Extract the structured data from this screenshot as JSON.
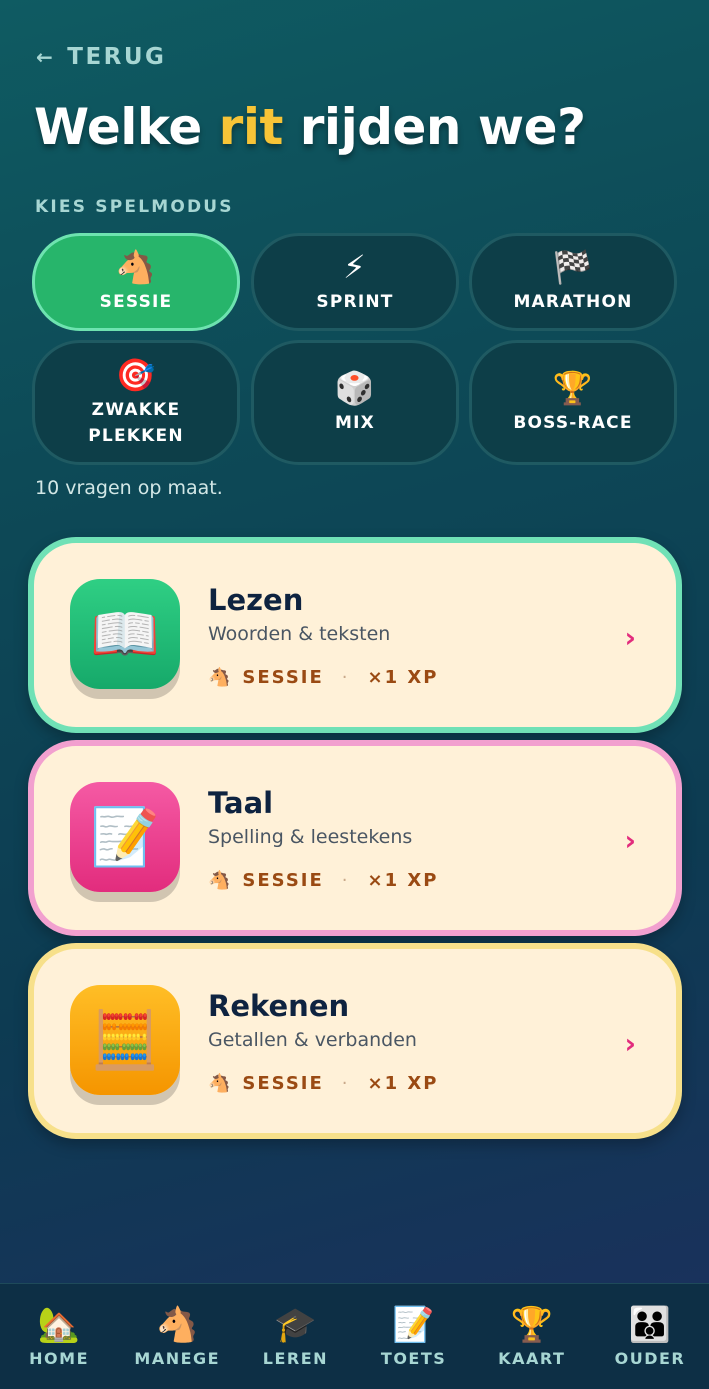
{
  "header": {
    "back_arrow": "←",
    "back_label": "TERUG",
    "title_before": "Welke ",
    "title_accent": "rit",
    "title_after": " rijden we?"
  },
  "mode_picker": {
    "heading": "KIES SPELMODUS",
    "modes": [
      {
        "label": "SESSIE",
        "icon": "🐴",
        "icon_name": "horse-icon",
        "active": true
      },
      {
        "label": "SPRINT",
        "icon": "⚡",
        "icon_name": "lightning-icon",
        "active": false
      },
      {
        "label": "MARATHON",
        "icon": "🏁",
        "icon_name": "checkered-flag-icon",
        "active": false
      },
      {
        "label": "ZWAKKE PLEKKEN",
        "icon": "🎯",
        "icon_name": "target-icon",
        "active": false
      },
      {
        "label": "MIX",
        "icon": "🎲",
        "icon_name": "dice-icon",
        "active": false
      },
      {
        "label": "BOSS-RACE",
        "icon": "🏆",
        "icon_name": "trophy-icon",
        "active": false
      }
    ],
    "hint": "10 vragen op maat."
  },
  "subjects": [
    {
      "title": "Lezen",
      "subtitle": "Woorden & teksten",
      "icon": "📖",
      "icon_name": "open-book-icon",
      "mode_icon": "🐴",
      "mode": "SESSIE",
      "dot": "·",
      "xp": "×1 XP",
      "chevron": "›",
      "border_color": "#70e1b6"
    },
    {
      "title": "Taal",
      "subtitle": "Spelling & leestekens",
      "icon": "📝",
      "icon_name": "writing-icon",
      "mode_icon": "🐴",
      "mode": "SESSIE",
      "dot": "·",
      "xp": "×1 XP",
      "chevron": "›",
      "border_color": "#f2a0cf"
    },
    {
      "title": "Rekenen",
      "subtitle": "Getallen & verbanden",
      "icon": "🧮",
      "icon_name": "calculator-icon",
      "mode_icon": "🐴",
      "mode": "SESSIE",
      "dot": "·",
      "xp": "×1 XP",
      "chevron": "›",
      "border_color": "#f7e08a"
    }
  ],
  "bottom_nav": [
    {
      "label": "HOME",
      "icon": "🏡",
      "icon_name": "house-icon"
    },
    {
      "label": "MANEGE",
      "icon": "🐴",
      "icon_name": "horse-icon"
    },
    {
      "label": "LEREN",
      "icon": "🎓",
      "icon_name": "graduation-cap-icon"
    },
    {
      "label": "TOETS",
      "icon": "📝",
      "icon_name": "memo-icon"
    },
    {
      "label": "KAART",
      "icon": "🏆",
      "icon_name": "trophy-icon"
    },
    {
      "label": "OUDER",
      "icon": "👪",
      "icon_name": "family-icon"
    }
  ],
  "colors": {
    "accent_yellow": "#f7c437",
    "active_green": "#27b56b",
    "chevron_pink": "#e22c7d"
  }
}
